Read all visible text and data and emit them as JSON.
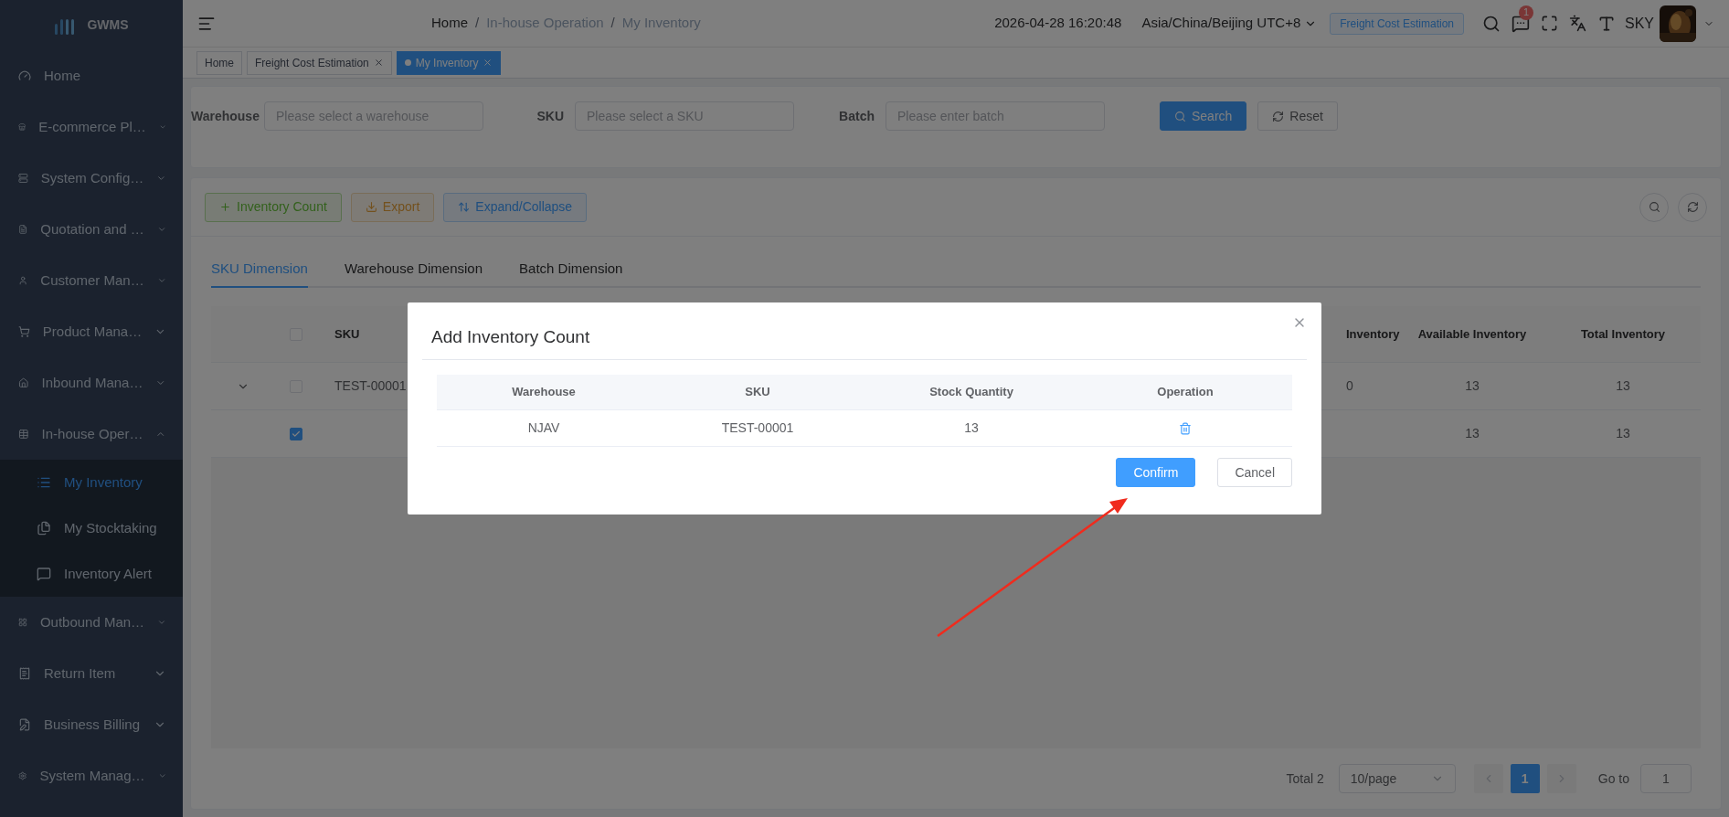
{
  "sidebar": {
    "logo": "GWMS",
    "items": [
      {
        "label": "Home",
        "kind": "link"
      },
      {
        "label": "E-commerce Pl…",
        "kind": "group",
        "expanded": false
      },
      {
        "label": "System Config…",
        "kind": "group",
        "expanded": false
      },
      {
        "label": "Quotation and …",
        "kind": "group",
        "expanded": false
      },
      {
        "label": "Customer Man…",
        "kind": "group",
        "expanded": false
      },
      {
        "label": "Product Mana…",
        "kind": "group",
        "expanded": false
      },
      {
        "label": "Inbound Mana…",
        "kind": "group",
        "expanded": false
      },
      {
        "label": "In-house Oper…",
        "kind": "group",
        "expanded": true,
        "children": [
          {
            "label": "My Inventory",
            "selected": true
          },
          {
            "label": "My Stocktaking",
            "selected": false
          },
          {
            "label": "Inventory Alert",
            "selected": false
          }
        ]
      },
      {
        "label": "Outbound Man…",
        "kind": "group",
        "expanded": false
      },
      {
        "label": "Return Item",
        "kind": "group",
        "expanded": false
      },
      {
        "label": "Business Billing",
        "kind": "group",
        "expanded": false
      },
      {
        "label": "System Manag…",
        "kind": "group",
        "expanded": false
      }
    ]
  },
  "header": {
    "breadcrumb_separator": "/",
    "breadcrumb": [
      {
        "label": "Home",
        "link": true
      },
      {
        "label": "In-house Operation",
        "link": false
      },
      {
        "label": "My Inventory",
        "link": false
      }
    ],
    "datetime": "2026-04-28 16:20:48",
    "timezone": "Asia/China/Beijing UTC+8",
    "freight_button": "Freight Cost Estimation",
    "message_badge": "1",
    "user": "SKY"
  },
  "tags": [
    {
      "label": "Home",
      "closable": false,
      "selected": false
    },
    {
      "label": "Freight Cost Estimation",
      "closable": true,
      "selected": false
    },
    {
      "label": "My Inventory",
      "closable": true,
      "selected": true
    }
  ],
  "filters": [
    {
      "label": "Warehouse",
      "placeholder": "Please select a warehouse"
    },
    {
      "label": "SKU",
      "placeholder": "Please select a SKU"
    },
    {
      "label": "Batch",
      "placeholder": "Please enter batch"
    }
  ],
  "filter_buttons": [
    {
      "label": "Search",
      "kind": "primary"
    },
    {
      "label": "Reset",
      "kind": "default"
    }
  ],
  "toolbar": [
    {
      "label": "Inventory Count",
      "kind": "success"
    },
    {
      "label": "Export",
      "kind": "warning"
    },
    {
      "label": "Expand/Collapse",
      "kind": "primary"
    }
  ],
  "dimension_tabs": [
    {
      "label": "SKU Dimension",
      "selected": true
    },
    {
      "label": "Warehouse Dimension",
      "selected": false
    },
    {
      "label": "Batch Dimension",
      "selected": false
    }
  ],
  "table": {
    "header_checked": false,
    "columns": [
      "SKU",
      "Inventory",
      "Available Inventory",
      "Total Inventory"
    ],
    "rows": [
      {
        "expandable": true,
        "checked": false,
        "sku": "TEST-00001",
        "column_4": "0",
        "available": "13",
        "total": "13"
      },
      {
        "expandable": false,
        "checked": true,
        "available": "13",
        "total": "13"
      }
    ]
  },
  "pagination": {
    "total": "Total 2",
    "page_size": "10/page",
    "pages": [
      {
        "label": "1",
        "selected": true
      }
    ],
    "goto_label": "Go to",
    "goto_value": "1"
  },
  "dialog": {
    "title": "Add Inventory Count",
    "columns": [
      "Warehouse",
      "SKU",
      "Stock Quantity",
      "Operation"
    ],
    "rows": [
      {
        "warehouse": "NJAV",
        "sku": "TEST-00001",
        "quantity": "13"
      }
    ],
    "buttons": [
      {
        "label": "Confirm",
        "kind": "primary"
      },
      {
        "label": "Cancel",
        "kind": "default"
      }
    ]
  }
}
